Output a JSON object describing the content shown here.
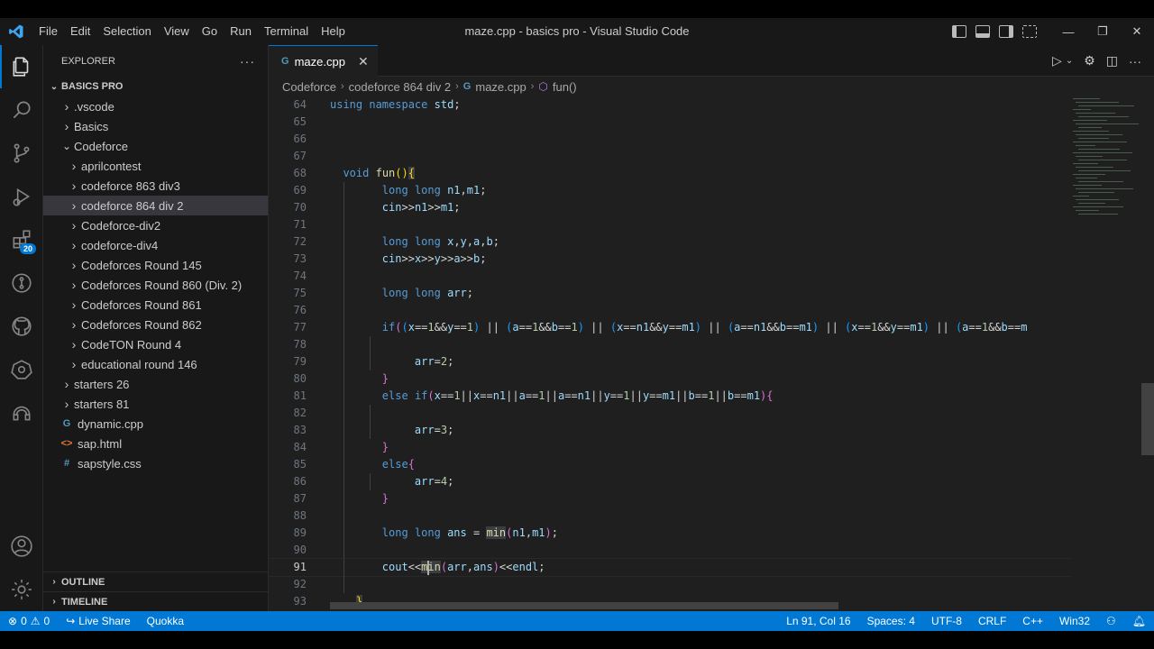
{
  "window": {
    "title": "maze.cpp - basics pro - Visual Studio Code",
    "minimize": "—",
    "restore": "❐",
    "close": "✕"
  },
  "menu": [
    "File",
    "Edit",
    "Selection",
    "View",
    "Go",
    "Run",
    "Terminal",
    "Help"
  ],
  "activity": {
    "extensions_badge": "20"
  },
  "sidebar": {
    "title": "EXPLORER",
    "more": "···",
    "workspace": "BASICS PRO",
    "tree": [
      {
        "label": ".vscode",
        "depth": 1,
        "type": "folder",
        "open": false
      },
      {
        "label": "Basics",
        "depth": 1,
        "type": "folder",
        "open": false
      },
      {
        "label": "Codeforce",
        "depth": 1,
        "type": "folder",
        "open": true
      },
      {
        "label": "aprilcontest",
        "depth": 2,
        "type": "folder",
        "open": false
      },
      {
        "label": "codeforce 863 div3",
        "depth": 2,
        "type": "folder",
        "open": false
      },
      {
        "label": "codeforce 864 div 2",
        "depth": 2,
        "type": "folder",
        "open": false,
        "selected": true
      },
      {
        "label": "Codeforce-div2",
        "depth": 2,
        "type": "folder",
        "open": false
      },
      {
        "label": "codeforce-div4",
        "depth": 2,
        "type": "folder",
        "open": false
      },
      {
        "label": "Codeforces Round 145",
        "depth": 2,
        "type": "folder",
        "open": false
      },
      {
        "label": "Codeforces Round 860 (Div. 2)",
        "depth": 2,
        "type": "folder",
        "open": false
      },
      {
        "label": "Codeforces Round 861",
        "depth": 2,
        "type": "folder",
        "open": false
      },
      {
        "label": "Codeforces Round 862",
        "depth": 2,
        "type": "folder",
        "open": false
      },
      {
        "label": "CodeTON Round 4",
        "depth": 2,
        "type": "folder",
        "open": false
      },
      {
        "label": "educational round 146",
        "depth": 2,
        "type": "folder",
        "open": false
      },
      {
        "label": "starters 26",
        "depth": 1,
        "type": "folder",
        "open": false
      },
      {
        "label": "starters 81",
        "depth": 1,
        "type": "folder",
        "open": false
      },
      {
        "label": "dynamic.cpp",
        "depth": 1,
        "type": "cpp",
        "glyph": "G"
      },
      {
        "label": "sap.html",
        "depth": 1,
        "type": "html",
        "glyph": "<>"
      },
      {
        "label": "sapstyle.css",
        "depth": 1,
        "type": "css",
        "glyph": "#"
      }
    ],
    "outline": "OUTLINE",
    "timeline": "TIMELINE"
  },
  "editor": {
    "tab": {
      "label": "maze.cpp",
      "icon_glyph": "G",
      "close": "✕"
    },
    "breadcrumb": [
      "Codeforce",
      "codeforce 864 div 2",
      "maze.cpp",
      "fun()"
    ],
    "current_line": "91",
    "lines": [
      {
        "n": "64",
        "html": "<span class=\"kw\">using</span> <span class=\"kw\">namespace</span> <span class=\"id\">std</span>;",
        "guides": 0
      },
      {
        "n": "65",
        "html": "",
        "guides": 0
      },
      {
        "n": "66",
        "html": "",
        "guides": 0
      },
      {
        "n": "67",
        "html": "",
        "guides": 0
      },
      {
        "n": "68",
        "html": "  <span class=\"ty\">void</span> <span class=\"fn\">fun</span><span class=\"br1\">()</span><span class=\"br1 hl\">{</span>",
        "guides": 0
      },
      {
        "n": "69",
        "html": "        <span class=\"ty\">long</span> <span class=\"ty\">long</span> <span class=\"id\">n1</span>,<span class=\"id\">m1</span>;",
        "guides": 1
      },
      {
        "n": "70",
        "html": "        <span class=\"id\">cin</span>&gt;&gt;<span class=\"id\">n1</span>&gt;&gt;<span class=\"id\">m1</span>;",
        "guides": 1
      },
      {
        "n": "71",
        "html": "",
        "guides": 1
      },
      {
        "n": "72",
        "html": "        <span class=\"ty\">long</span> <span class=\"ty\">long</span> <span class=\"id\">x</span>,<span class=\"id\">y</span>,<span class=\"id\">a</span>,<span class=\"id\">b</span>;",
        "guides": 1
      },
      {
        "n": "73",
        "html": "        <span class=\"id\">cin</span>&gt;&gt;<span class=\"id\">x</span>&gt;&gt;<span class=\"id\">y</span>&gt;&gt;<span class=\"id\">a</span>&gt;&gt;<span class=\"id\">b</span>;",
        "guides": 1
      },
      {
        "n": "74",
        "html": "",
        "guides": 1
      },
      {
        "n": "75",
        "html": "        <span class=\"ty\">long</span> <span class=\"ty\">long</span> <span class=\"id\">arr</span>;",
        "guides": 1
      },
      {
        "n": "76",
        "html": "",
        "guides": 1
      },
      {
        "n": "77",
        "html": "        <span class=\"kw\">if</span><span class=\"br2\">(</span><span class=\"br3\">(</span><span class=\"id\">x</span>==<span class=\"num\">1</span>&amp;&amp;<span class=\"id\">y</span>==<span class=\"num\">1</span><span class=\"br3\">)</span> || <span class=\"br3\">(</span><span class=\"id\">a</span>==<span class=\"num\">1</span>&amp;&amp;<span class=\"id\">b</span>==<span class=\"num\">1</span><span class=\"br3\">)</span> || <span class=\"br3\">(</span><span class=\"id\">x</span>==<span class=\"id\">n1</span>&amp;&amp;<span class=\"id\">y</span>==<span class=\"id\">m1</span><span class=\"br3\">)</span> || <span class=\"br3\">(</span><span class=\"id\">a</span>==<span class=\"id\">n1</span>&amp;&amp;<span class=\"id\">b</span>==<span class=\"id\">m1</span><span class=\"br3\">)</span> || <span class=\"br3\">(</span><span class=\"id\">x</span>==<span class=\"num\">1</span>&amp;&amp;<span class=\"id\">y</span>==<span class=\"id\">m1</span><span class=\"br3\">)</span> || <span class=\"br3\">(</span><span class=\"id\">a</span>==<span class=\"num\">1</span>&amp;&amp;<span class=\"id\">b</span>==<span class=\"id\">m</span>",
        "guides": 1
      },
      {
        "n": "78",
        "html": "",
        "guides": 2
      },
      {
        "n": "79",
        "html": "             <span class=\"id\">arr</span>=<span class=\"num\">2</span>;",
        "guides": 2
      },
      {
        "n": "80",
        "html": "        <span class=\"br2\">}</span>",
        "guides": 1
      },
      {
        "n": "81",
        "html": "        <span class=\"kw\">else</span> <span class=\"kw\">if</span><span class=\"br2\">(</span><span class=\"id\">x</span>==<span class=\"num\">1</span>||<span class=\"id\">x</span>==<span class=\"id\">n1</span>||<span class=\"id\">a</span>==<span class=\"num\">1</span>||<span class=\"id\">a</span>==<span class=\"id\">n1</span>||<span class=\"id\">y</span>==<span class=\"num\">1</span>||<span class=\"id\">y</span>==<span class=\"id\">m1</span>||<span class=\"id\">b</span>==<span class=\"num\">1</span>||<span class=\"id\">b</span>==<span class=\"id\">m1</span><span class=\"br2\">)</span><span class=\"br2\">{</span>",
        "guides": 1
      },
      {
        "n": "82",
        "html": "",
        "guides": 2
      },
      {
        "n": "83",
        "html": "             <span class=\"id\">arr</span>=<span class=\"num\">3</span>;",
        "guides": 2
      },
      {
        "n": "84",
        "html": "        <span class=\"br2\">}</span>",
        "guides": 1
      },
      {
        "n": "85",
        "html": "        <span class=\"kw\">else</span><span class=\"br2\">{</span>",
        "guides": 1
      },
      {
        "n": "86",
        "html": "             <span class=\"id\">arr</span>=<span class=\"num\">4</span>;",
        "guides": 2
      },
      {
        "n": "87",
        "html": "        <span class=\"br2\">}</span>",
        "guides": 1
      },
      {
        "n": "88",
        "html": "",
        "guides": 1
      },
      {
        "n": "89",
        "html": "        <span class=\"ty\">long</span> <span class=\"ty\">long</span> <span class=\"id\">ans</span> = <span class=\"fn hl\">min</span><span class=\"br2\">(</span><span class=\"id\">n1</span>,<span class=\"id\">m1</span><span class=\"br2\">)</span>;",
        "guides": 1
      },
      {
        "n": "90",
        "html": "",
        "guides": 1
      },
      {
        "n": "91",
        "html": "        <span class=\"id\">cout</span>&lt;&lt;<span class=\"fn hl\">m<span class=\"cursor\"></span>in</span><span class=\"br2\">(</span><span class=\"id\">arr</span>,<span class=\"id\">ans</span><span class=\"br2\">)</span>&lt;&lt;<span class=\"id\">endl</span>;",
        "guides": 1
      },
      {
        "n": "92",
        "html": "",
        "guides": 1
      },
      {
        "n": "93",
        "html": "    <span class=\"br1 hl\">}</span>",
        "guides": 0
      }
    ]
  },
  "status": {
    "errors": "0",
    "warnings": "0",
    "live_share": "Live Share",
    "quokka": "Quokka",
    "position": "Ln 91, Col 16",
    "spaces": "Spaces: 4",
    "encoding": "UTF-8",
    "eol": "CRLF",
    "language": "C++",
    "platform": "Win32"
  },
  "colors": {
    "accent": "#0078d4",
    "statusbar": "#0078d4",
    "editor_bg": "#1f1f1f",
    "sidebar_bg": "#181818"
  }
}
